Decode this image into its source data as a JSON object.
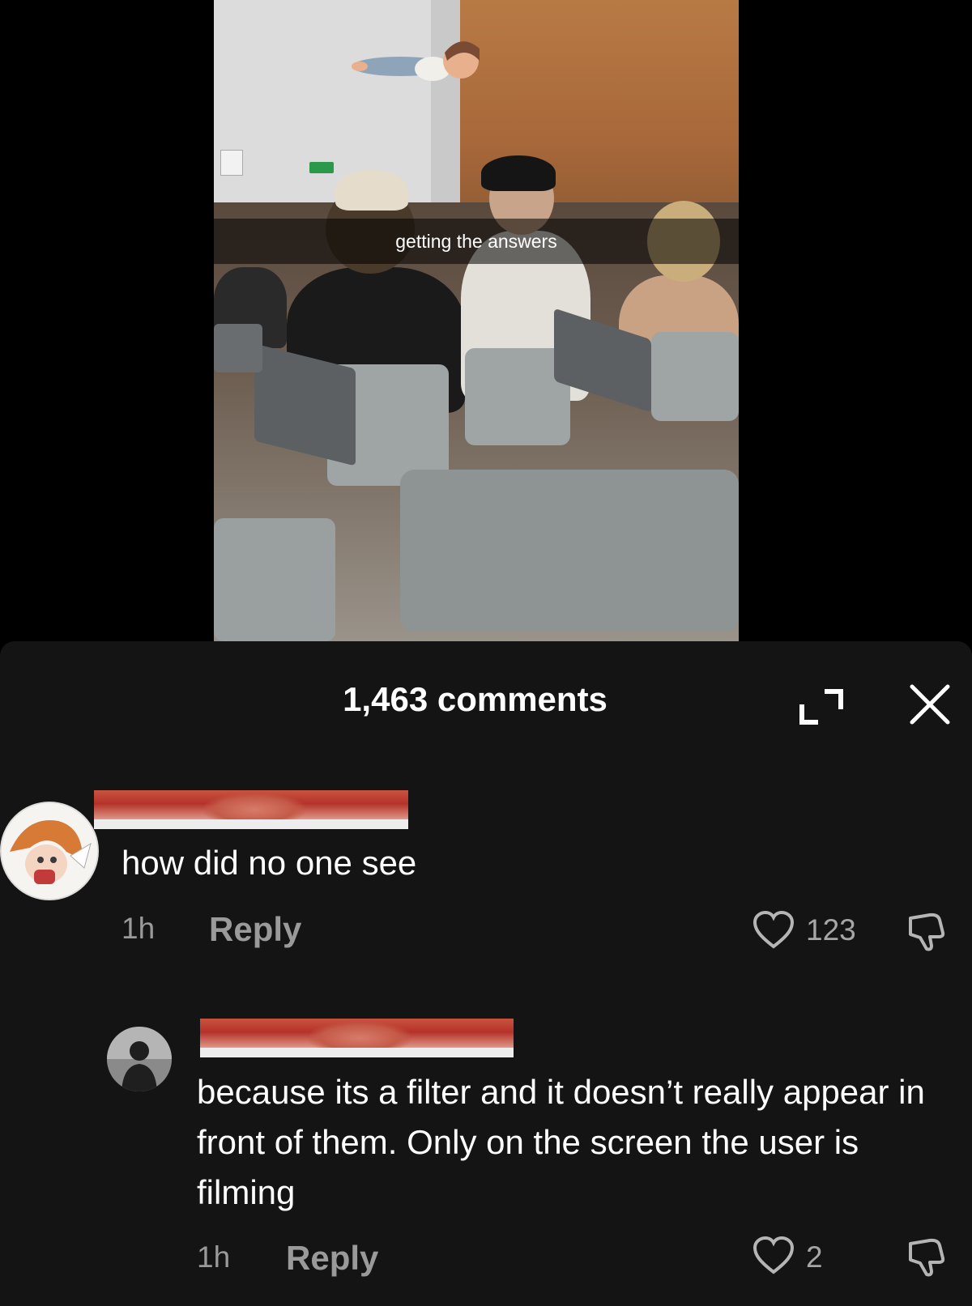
{
  "video": {
    "caption": "getting the answers"
  },
  "header": {
    "comment_count": "1,463 comments",
    "expand_icon": "expand-icon",
    "close_icon": "close-icon"
  },
  "comments": [
    {
      "text": "how did no one see",
      "time": "1h",
      "reply_label": "Reply",
      "like_count": "123"
    },
    {
      "text": "because its a filter and it doesn’t really appear in front of them. Only on the screen the user is filming",
      "time": "1h",
      "reply_label": "Reply",
      "like_count": "2"
    }
  ],
  "colors": {
    "sheet_background": "#141414",
    "secondary_text": "#9a9a9a"
  }
}
